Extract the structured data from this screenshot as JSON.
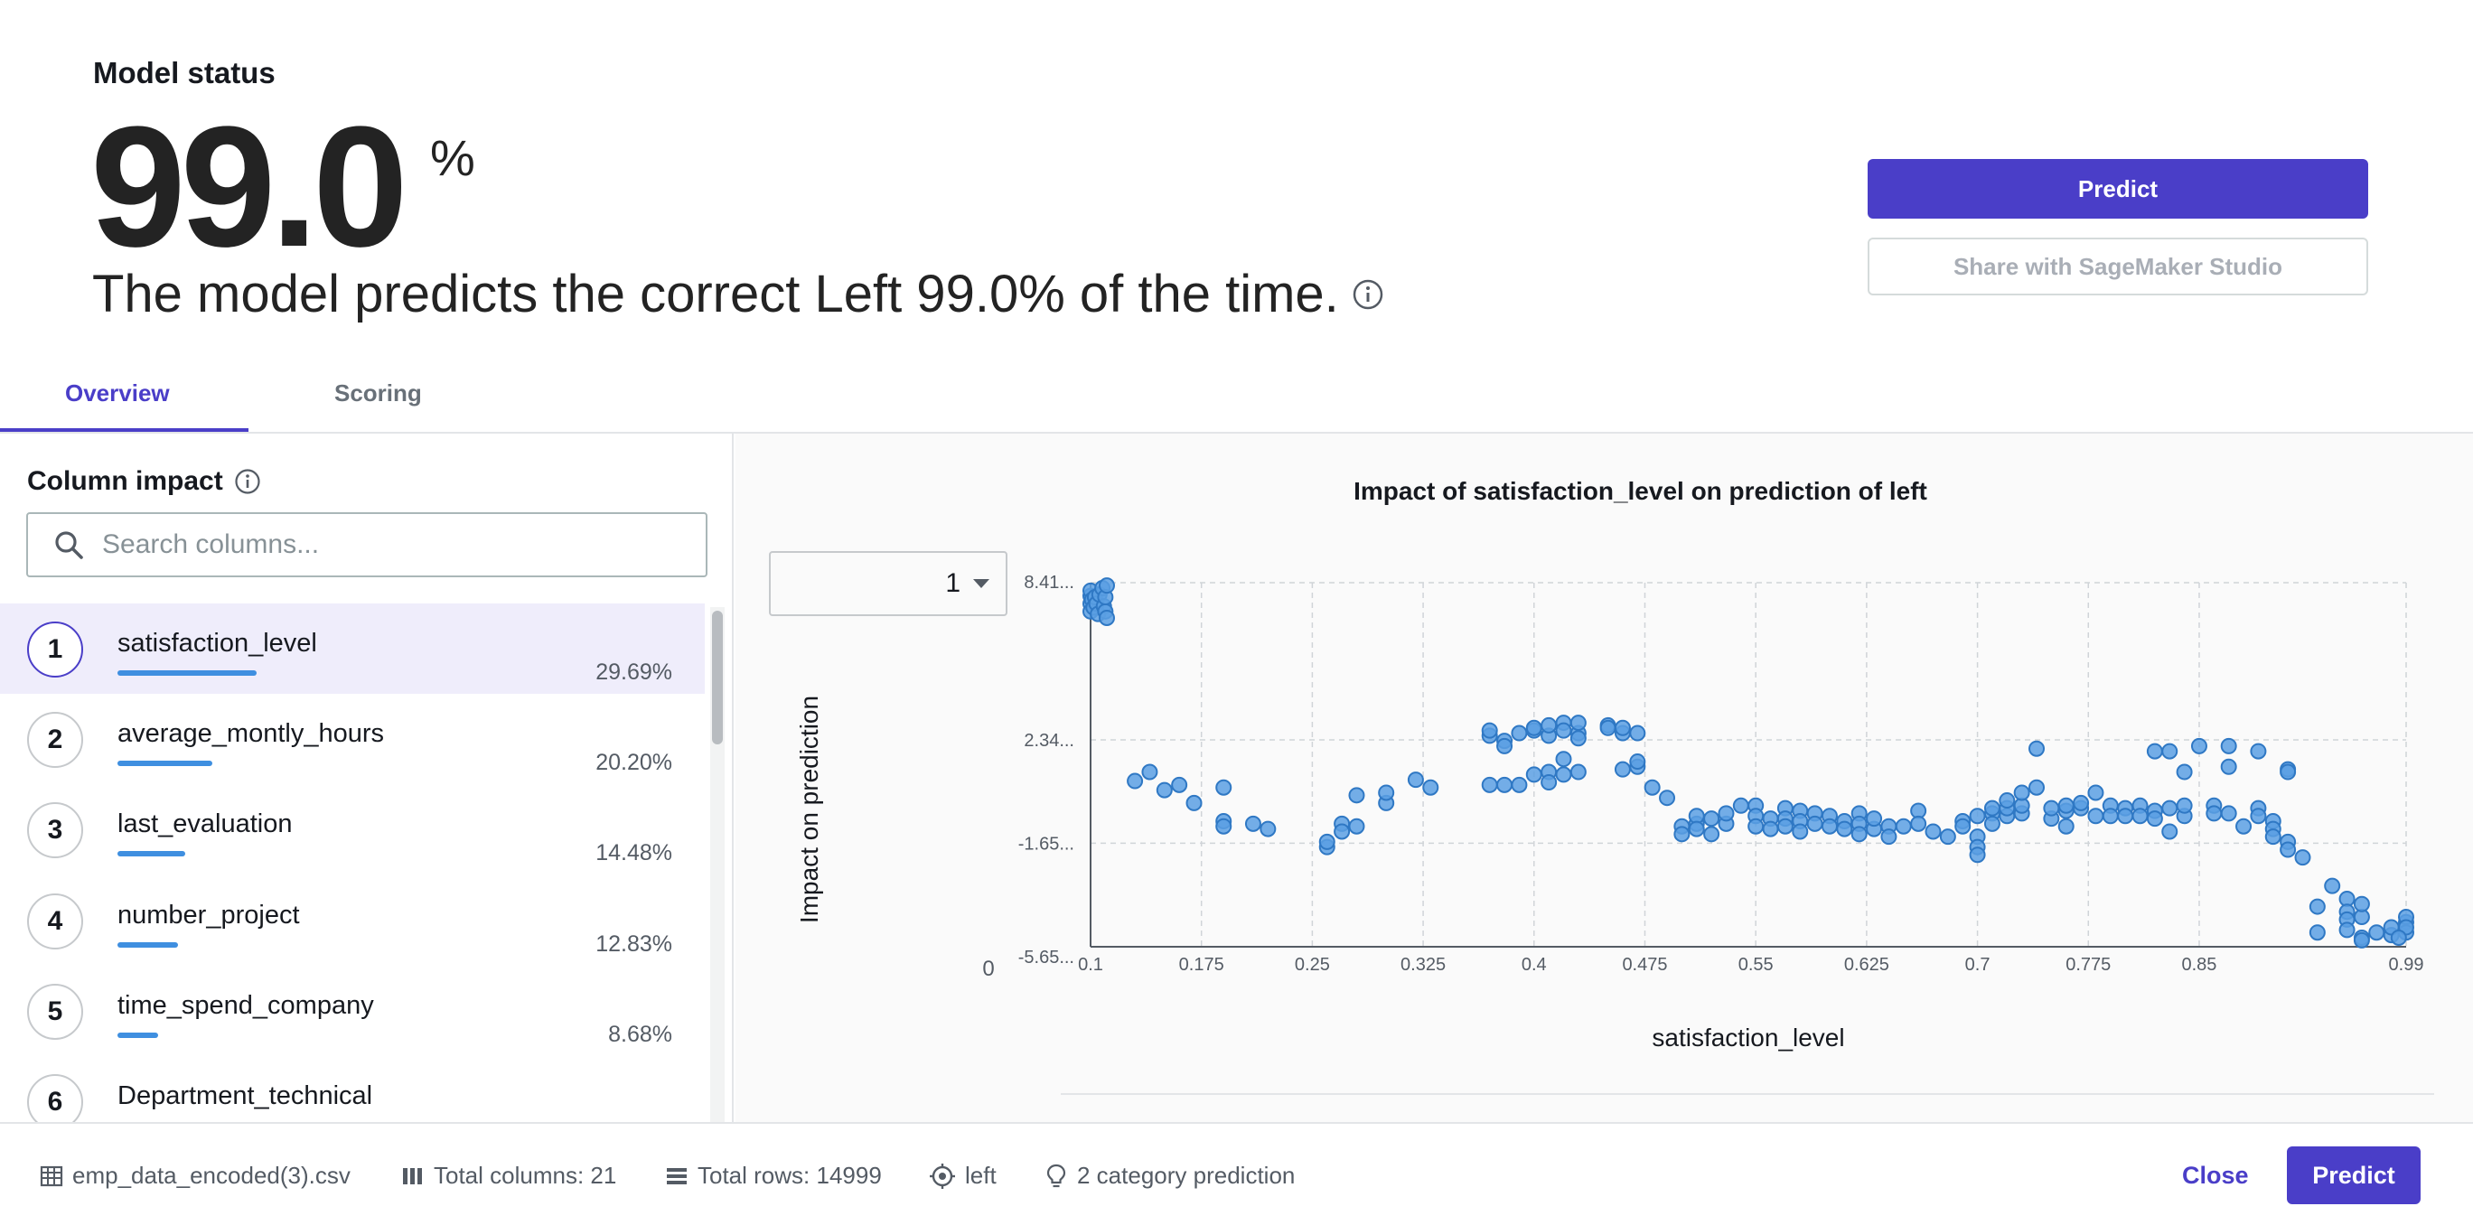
{
  "header": {
    "section_title": "Model status",
    "accuracy_value": "99.0",
    "accuracy_unit": "%",
    "subtitle": "The model predicts the correct Left 99.0% of the time.",
    "predict_label": "Predict",
    "share_label": "Share with SageMaker Studio"
  },
  "tabs": [
    {
      "label": "Overview",
      "active": true
    },
    {
      "label": "Scoring",
      "active": false
    }
  ],
  "column_impact": {
    "title": "Column impact",
    "search_placeholder": "Search columns...",
    "items": [
      {
        "rank": "1",
        "name": "satisfaction_level",
        "percent": "29.69%",
        "value": 29.69
      },
      {
        "rank": "2",
        "name": "average_montly_hours",
        "percent": "20.20%",
        "value": 20.2
      },
      {
        "rank": "3",
        "name": "last_evaluation",
        "percent": "14.48%",
        "value": 14.48
      },
      {
        "rank": "4",
        "name": "number_project",
        "percent": "12.83%",
        "value": 12.83
      },
      {
        "rank": "5",
        "name": "time_spend_company",
        "percent": "8.68%",
        "value": 8.68
      },
      {
        "rank": "6",
        "name": "Department_technical",
        "percent": "",
        "value": 0
      }
    ]
  },
  "chart_panel": {
    "class_select_value": "1"
  },
  "chart_data": {
    "type": "scatter",
    "title": "Impact of satisfaction_level on prediction of left",
    "xlabel": "satisfaction_level",
    "ylabel": "Impact on prediction",
    "xlim": [
      0.1,
      0.99
    ],
    "ylim": [
      -5.65,
      8.41
    ],
    "x_ticks": [
      "0.1",
      "0.175",
      "0.25",
      "0.325",
      "0.4",
      "0.475",
      "0.55",
      "0.625",
      "0.7",
      "0.775",
      "0.85",
      "0.99"
    ],
    "x_tick_values": [
      0.1,
      0.175,
      0.25,
      0.325,
      0.4,
      0.475,
      0.55,
      0.625,
      0.7,
      0.775,
      0.85,
      0.99
    ],
    "y_ticks": [
      "8.41...",
      "2.34...",
      "-1.65...",
      "-5.65..."
    ],
    "y_tick_values": [
      8.41,
      2.34,
      -1.65,
      -5.65
    ],
    "y_zero_label": "0",
    "grid": true,
    "point_color": "#5b9fe3",
    "points": [
      [
        0.1,
        7.9
      ],
      [
        0.1,
        7.6
      ],
      [
        0.1,
        7.3
      ],
      [
        0.1,
        8.1
      ],
      [
        0.101,
        7.75
      ],
      [
        0.102,
        7.45
      ],
      [
        0.103,
        7.85
      ],
      [
        0.104,
        7.6
      ],
      [
        0.105,
        7.2
      ],
      [
        0.106,
        7.95
      ],
      [
        0.108,
        8.2
      ],
      [
        0.109,
        7.5
      ],
      [
        0.11,
        7.3
      ],
      [
        0.11,
        7.85
      ],
      [
        0.111,
        8.3
      ],
      [
        0.111,
        7.05
      ],
      [
        0.13,
        0.75
      ],
      [
        0.14,
        1.1
      ],
      [
        0.15,
        0.4
      ],
      [
        0.16,
        0.6
      ],
      [
        0.17,
        -0.1
      ],
      [
        0.19,
        0.5
      ],
      [
        0.19,
        -0.8
      ],
      [
        0.19,
        -1.0
      ],
      [
        0.21,
        -0.9
      ],
      [
        0.22,
        -1.1
      ],
      [
        0.26,
        -1.8
      ],
      [
        0.26,
        -1.6
      ],
      [
        0.27,
        -0.9
      ],
      [
        0.27,
        -1.2
      ],
      [
        0.28,
        -1.0
      ],
      [
        0.28,
        0.2
      ],
      [
        0.3,
        -0.1
      ],
      [
        0.3,
        0.3
      ],
      [
        0.32,
        0.8
      ],
      [
        0.33,
        0.5
      ],
      [
        0.37,
        2.5
      ],
      [
        0.37,
        2.7
      ],
      [
        0.38,
        2.3
      ],
      [
        0.38,
        2.1
      ],
      [
        0.39,
        2.6
      ],
      [
        0.4,
        2.7
      ],
      [
        0.4,
        2.8
      ],
      [
        0.41,
        2.5
      ],
      [
        0.41,
        2.9
      ],
      [
        0.42,
        3.0
      ],
      [
        0.42,
        2.7
      ],
      [
        0.43,
        2.6
      ],
      [
        0.43,
        2.4
      ],
      [
        0.43,
        3.0
      ],
      [
        0.37,
        0.6
      ],
      [
        0.38,
        0.6
      ],
      [
        0.39,
        0.6
      ],
      [
        0.4,
        1.0
      ],
      [
        0.41,
        1.1
      ],
      [
        0.41,
        0.7
      ],
      [
        0.42,
        1.0
      ],
      [
        0.42,
        1.6
      ],
      [
        0.43,
        1.1
      ],
      [
        0.45,
        2.9
      ],
      [
        0.45,
        2.8
      ],
      [
        0.46,
        2.6
      ],
      [
        0.46,
        2.8
      ],
      [
        0.47,
        2.6
      ],
      [
        0.46,
        1.2
      ],
      [
        0.47,
        1.3
      ],
      [
        0.47,
        1.5
      ],
      [
        0.48,
        0.5
      ],
      [
        0.49,
        0.1
      ],
      [
        0.5,
        -1.0
      ],
      [
        0.5,
        -1.3
      ],
      [
        0.51,
        -0.9
      ],
      [
        0.51,
        -0.6
      ],
      [
        0.51,
        -1.1
      ],
      [
        0.52,
        -0.7
      ],
      [
        0.52,
        -1.3
      ],
      [
        0.53,
        -0.9
      ],
      [
        0.53,
        -0.5
      ],
      [
        0.54,
        -0.2
      ],
      [
        0.55,
        -0.2
      ],
      [
        0.55,
        -0.6
      ],
      [
        0.55,
        -1.0
      ],
      [
        0.56,
        -0.7
      ],
      [
        0.56,
        -1.1
      ],
      [
        0.57,
        -0.3
      ],
      [
        0.57,
        -0.7
      ],
      [
        0.57,
        -1.0
      ],
      [
        0.58,
        -0.4
      ],
      [
        0.58,
        -0.8
      ],
      [
        0.58,
        -1.2
      ],
      [
        0.59,
        -0.5
      ],
      [
        0.59,
        -0.9
      ],
      [
        0.6,
        -0.6
      ],
      [
        0.6,
        -1.0
      ],
      [
        0.61,
        -0.8
      ],
      [
        0.61,
        -1.1
      ],
      [
        0.62,
        -0.5
      ],
      [
        0.62,
        -0.9
      ],
      [
        0.62,
        -1.3
      ],
      [
        0.63,
        -1.1
      ],
      [
        0.63,
        -0.7
      ],
      [
        0.64,
        -1.0
      ],
      [
        0.64,
        -1.4
      ],
      [
        0.65,
        -1.0
      ],
      [
        0.66,
        -0.4
      ],
      [
        0.66,
        -0.9
      ],
      [
        0.67,
        -1.2
      ],
      [
        0.68,
        -1.4
      ],
      [
        0.69,
        -0.8
      ],
      [
        0.69,
        -1.0
      ],
      [
        0.7,
        -1.4
      ],
      [
        0.7,
        -1.8
      ],
      [
        0.7,
        -2.1
      ],
      [
        0.7,
        -0.6
      ],
      [
        0.71,
        -0.5
      ],
      [
        0.71,
        -0.9
      ],
      [
        0.71,
        -0.3
      ],
      [
        0.72,
        -0.6
      ],
      [
        0.72,
        -0.3
      ],
      [
        0.72,
        0.0
      ],
      [
        0.73,
        -0.5
      ],
      [
        0.73,
        -0.2
      ],
      [
        0.73,
        0.3
      ],
      [
        0.74,
        0.5
      ],
      [
        0.74,
        2.0
      ],
      [
        0.75,
        -0.7
      ],
      [
        0.75,
        -0.3
      ],
      [
        0.76,
        -0.4
      ],
      [
        0.76,
        -1.0
      ],
      [
        0.76,
        -0.2
      ],
      [
        0.77,
        -0.3
      ],
      [
        0.77,
        -0.1
      ],
      [
        0.78,
        -0.6
      ],
      [
        0.78,
        0.3
      ],
      [
        0.79,
        -0.2
      ],
      [
        0.79,
        -0.6
      ],
      [
        0.8,
        -0.3
      ],
      [
        0.8,
        -0.6
      ],
      [
        0.81,
        -0.2
      ],
      [
        0.81,
        -0.6
      ],
      [
        0.82,
        -0.4
      ],
      [
        0.82,
        -0.7
      ],
      [
        0.83,
        -0.3
      ],
      [
        0.83,
        -1.2
      ],
      [
        0.84,
        -0.6
      ],
      [
        0.84,
        -0.2
      ],
      [
        0.82,
        1.9
      ],
      [
        0.83,
        1.9
      ],
      [
        0.84,
        1.1
      ],
      [
        0.85,
        2.1
      ],
      [
        0.86,
        -0.2
      ],
      [
        0.86,
        -0.5
      ],
      [
        0.87,
        2.1
      ],
      [
        0.87,
        1.3
      ],
      [
        0.87,
        -0.5
      ],
      [
        0.88,
        -1.0
      ],
      [
        0.89,
        1.9
      ],
      [
        0.89,
        -0.3
      ],
      [
        0.89,
        -0.6
      ],
      [
        0.9,
        -0.8
      ],
      [
        0.9,
        -1.1
      ],
      [
        0.9,
        -1.4
      ],
      [
        0.91,
        1.2
      ],
      [
        0.91,
        1.1
      ],
      [
        0.91,
        -1.6
      ],
      [
        0.91,
        -1.9
      ],
      [
        0.92,
        -2.2
      ],
      [
        0.93,
        -4.1
      ],
      [
        0.93,
        -5.1
      ],
      [
        0.94,
        -3.3
      ],
      [
        0.95,
        -3.8
      ],
      [
        0.95,
        -4.3
      ],
      [
        0.95,
        -4.6
      ],
      [
        0.95,
        -5.0
      ],
      [
        0.96,
        -5.3
      ],
      [
        0.96,
        -5.4
      ],
      [
        0.96,
        -4.5
      ],
      [
        0.96,
        -4.0
      ],
      [
        0.97,
        -5.1
      ],
      [
        0.98,
        -5.2
      ],
      [
        0.98,
        -4.9
      ],
      [
        0.99,
        -4.7
      ],
      [
        0.99,
        -4.5
      ],
      [
        0.99,
        -5.1
      ],
      [
        0.99,
        -4.9
      ],
      [
        0.985,
        -5.3
      ]
    ]
  },
  "footer": {
    "file_name": "emp_data_encoded(3).csv",
    "total_columns": "Total columns: 21",
    "total_rows": "Total rows: 14999",
    "target": "left",
    "prediction_type": "2 category prediction",
    "close_label": "Close",
    "predict_label": "Predict"
  },
  "colors": {
    "accent": "#4a3ec8",
    "bar": "#3f8fe0",
    "point": "#5b9fe3",
    "selected_row": "#efedfb"
  }
}
